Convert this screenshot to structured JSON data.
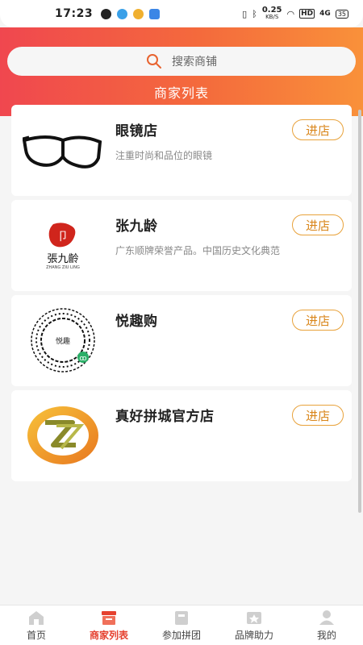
{
  "status_bar": {
    "time": "17:23",
    "network_speed": "0.25",
    "speed_unit": "KB/S",
    "hd": "HD",
    "signal": "4G",
    "battery": "35"
  },
  "search": {
    "placeholder": "搜索商铺"
  },
  "page_title": "商家列表",
  "colors": {
    "header_start": "#f0474f",
    "header_end": "#f9913a",
    "accent": "#e5412f",
    "button_border": "#e8a23b"
  },
  "shops": [
    {
      "name": "眼镜店",
      "description": "注重时尚和品位的眼镜",
      "button": "进店",
      "logo_icon": "glasses-logo"
    },
    {
      "name": "张九龄",
      "description": "广东顺牌荣誉产品。中国历史文化典范",
      "button": "进店",
      "logo_icon": "zhang-jiuling-logo",
      "logo_text": "張九齡",
      "logo_subtext": "ZHANG ZIU LING"
    },
    {
      "name": "悦趣购",
      "description": "",
      "button": "进店",
      "logo_icon": "mini-program-qr-code"
    },
    {
      "name": "真好拼城官方店",
      "description": "",
      "button": "进店",
      "logo_icon": "zh-brand-logo"
    }
  ],
  "tabbar": {
    "items": [
      {
        "label": "首页",
        "icon": "home-icon",
        "active": false
      },
      {
        "label": "商家列表",
        "icon": "shop-list-icon",
        "active": true
      },
      {
        "label": "参加拼团",
        "icon": "group-buy-icon",
        "active": false
      },
      {
        "label": "品牌助力",
        "icon": "brand-boost-icon",
        "active": false
      },
      {
        "label": "我的",
        "icon": "profile-icon",
        "active": false
      }
    ]
  }
}
